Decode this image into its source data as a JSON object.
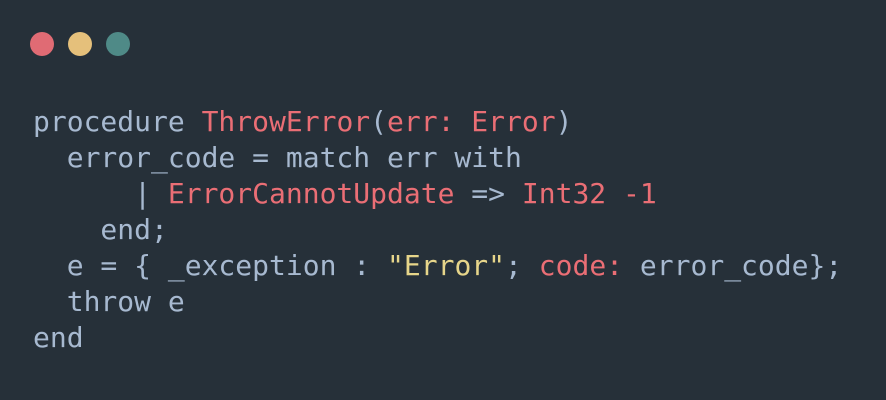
{
  "window": {
    "traffic_lights": [
      {
        "name": "close-dot",
        "color": "#e06b74"
      },
      {
        "name": "minimize-dot",
        "color": "#e5c07b"
      },
      {
        "name": "maximize-dot",
        "color": "#4f8a87"
      }
    ]
  },
  "colors": {
    "background": "#263039",
    "plain": "#a7b9d0",
    "red": "#ea6e75",
    "yellow": "#e6d58a",
    "operator": "#c9d6e3"
  },
  "code": {
    "lines": [
      [
        {
          "text": "procedure ",
          "color": "plain"
        },
        {
          "text": "ThrowError",
          "color": "red"
        },
        {
          "text": "(",
          "color": "plain"
        },
        {
          "text": "err: Error",
          "color": "red"
        },
        {
          "text": ")",
          "color": "plain"
        }
      ],
      [
        {
          "text": "  error_code = match err with",
          "color": "plain"
        }
      ],
      [
        {
          "text": "      | ",
          "color": "plain"
        },
        {
          "text": "ErrorCannotUpdate",
          "color": "red"
        },
        {
          "text": " => ",
          "color": "plain"
        },
        {
          "text": "Int32 -1",
          "color": "red"
        }
      ],
      [
        {
          "text": "    end;",
          "color": "plain"
        }
      ],
      [
        {
          "text": "  e = { _exception : ",
          "color": "plain"
        },
        {
          "text": "\"Error\"",
          "color": "yellow"
        },
        {
          "text": "; ",
          "color": "plain"
        },
        {
          "text": "code:",
          "color": "red"
        },
        {
          "text": " error_code};",
          "color": "plain"
        }
      ],
      [
        {
          "text": "  throw e",
          "color": "plain"
        }
      ],
      [
        {
          "text": "end",
          "color": "plain"
        }
      ]
    ]
  }
}
